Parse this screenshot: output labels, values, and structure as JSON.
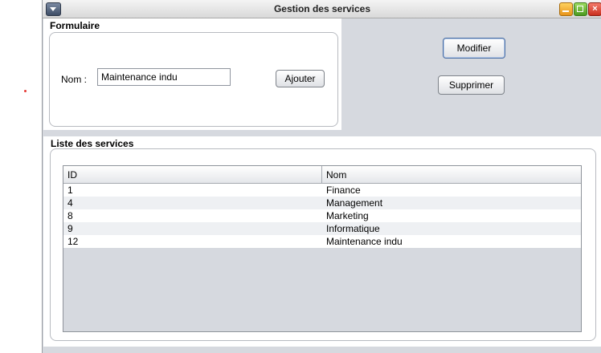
{
  "window": {
    "title": "Gestion des services"
  },
  "form": {
    "section_title": "Formulaire",
    "nom_label": "Nom :",
    "nom_value": "Maintenance indu",
    "ajouter_label": "Ajouter"
  },
  "actions": {
    "modifier_label": "Modifier",
    "supprimer_label": "Supprimer"
  },
  "list": {
    "section_title": "Liste des services",
    "columns": [
      "ID",
      "Nom"
    ],
    "rows": [
      {
        "id": "1",
        "nom": "Finance"
      },
      {
        "id": "4",
        "nom": "Management"
      },
      {
        "id": "8",
        "nom": "Marketing"
      },
      {
        "id": "9",
        "nom": "Informatique"
      },
      {
        "id": "12",
        "nom": "Maintenance indu"
      }
    ]
  },
  "icons": {
    "system_menu": "chevron-down-icon",
    "minimize": "minimize-icon",
    "maximize": "maximize-icon",
    "close": "close-icon"
  }
}
